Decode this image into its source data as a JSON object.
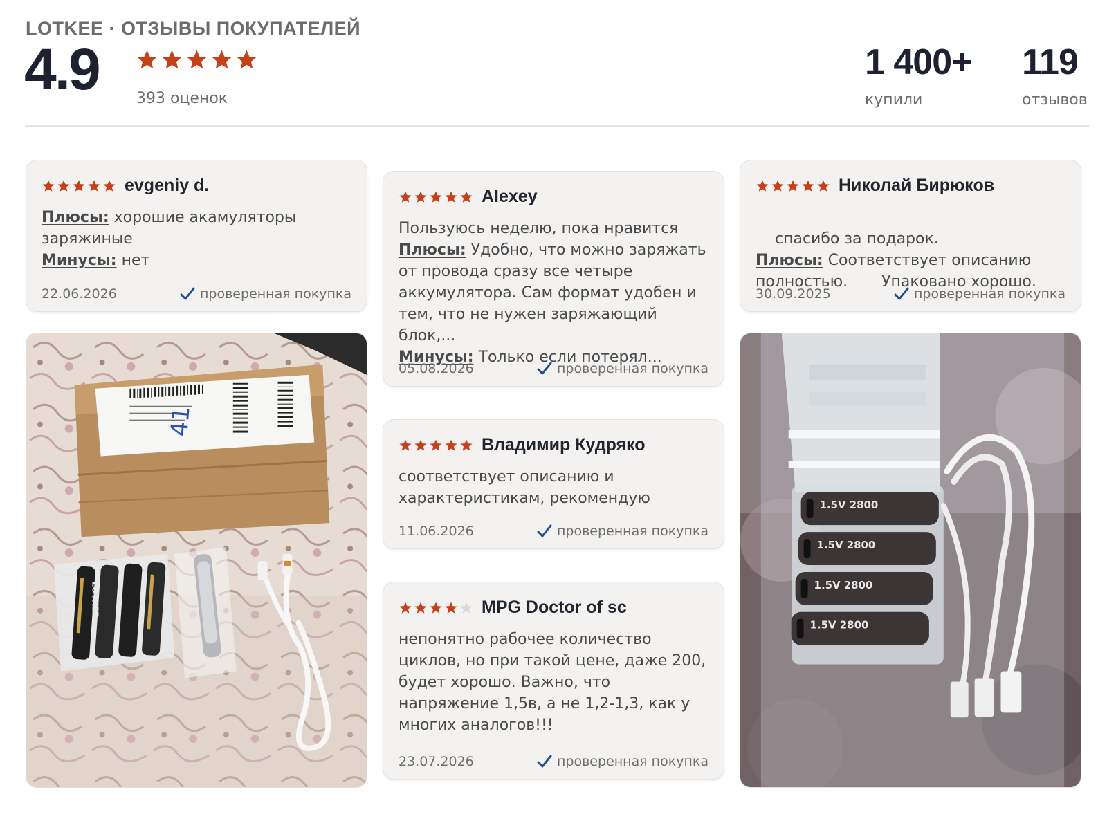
{
  "header": {
    "title": "LOTKEE · ОТЗЫВЫ ПОКУПАТЕЛЕЙ",
    "rating": "4.9",
    "rating_stars": 5,
    "rating_count": "393 оценок",
    "bought_value": "1 400+",
    "bought_label": "купили",
    "reviews_value": "119",
    "reviews_label": "отзывов"
  },
  "colors": {
    "star": "#c4411a",
    "star_empty": "#d9d9d9",
    "check": "#1f4e8c"
  },
  "reviews": [
    {
      "stars": 5,
      "author": "evgeniy d.",
      "plus_label": "Плюсы:",
      "plus_text": "хорошие акамуляторы заряжиные",
      "minus_label": "Минусы:",
      "minus_text": "нет",
      "date": "22.06.2026",
      "verified": "проверенная покупка"
    },
    {
      "stars": 5,
      "author": "Alexey",
      "text": "Пользуюсь неделю, пока нравится",
      "plus_label": "Плюсы:",
      "plus_text": "Удобно, что можно заряжать от провода сразу все четыре аккумулятора. Сам формат удобен и тем, что не нужен заряжающий блок,...",
      "minus_label": "Минусы:",
      "minus_text": "Только если потерял...",
      "date": "05.08.2026",
      "verified": "проверенная покупка"
    },
    {
      "stars": 5,
      "author": "Николай Бирюков",
      "text": "спасибо за подарок.",
      "plus_label": "Плюсы:",
      "plus_text": "Соответствует описанию полностью.       Упаковано хорошо.",
      "date": "30.09.2025",
      "verified": "проверенная покупка"
    },
    {
      "stars": 5,
      "author": "Владимир Кудряко",
      "text": "соответствует описанию и характеристикам, рекомендую",
      "date": "11.06.2026",
      "verified": "проверенная покупка"
    },
    {
      "stars": 4,
      "author": "MPG Doctor of sc",
      "text": "непонятно рабочее количество циклов, но при такой цене, даже 200, будет хорошо. Важно, что напряжение 1,5в, а не 1,2-1,3, как у многих аналогов!!!",
      "date": "23.07.2026",
      "verified": "проверенная покупка"
    }
  ],
  "photos": {
    "photo1": {
      "icon": "photo-icon",
      "box_text": "41",
      "battery_brand": "LOTKEE"
    },
    "photo2": {
      "icon": "photo-icon",
      "battery_label": "1.5V 2800"
    }
  }
}
